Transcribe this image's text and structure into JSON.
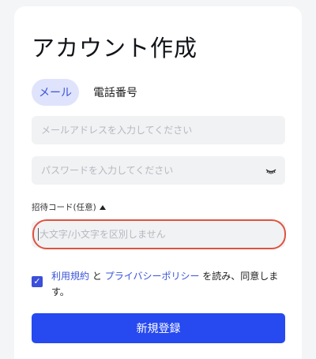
{
  "page": {
    "title": "アカウント作成"
  },
  "tabs": [
    {
      "label": "メール",
      "active": true
    },
    {
      "label": "電話番号",
      "active": false
    }
  ],
  "form": {
    "email_placeholder": "メールアドレスを入力してください",
    "email_value": "",
    "password_placeholder": "パスワードを入力してください",
    "password_value": "",
    "password_toggle_icon": "eye-closed-icon",
    "invite_label": "招待コード(任意)",
    "invite_toggle_icon": "caret-up-icon",
    "invite_placeholder": "大文字/小文字を区別しません",
    "invite_value": ""
  },
  "agreement": {
    "checked": true,
    "terms_link": "利用規約",
    "connector": "と",
    "privacy_link": "プライバシーポリシー",
    "suffix": "を読み、同意します。"
  },
  "submit_label": "新規登録",
  "colors": {
    "accent": "#2649f0",
    "link": "#3b54d9",
    "tab_active_bg": "#dfe3fb",
    "highlight": "#e0523f"
  }
}
